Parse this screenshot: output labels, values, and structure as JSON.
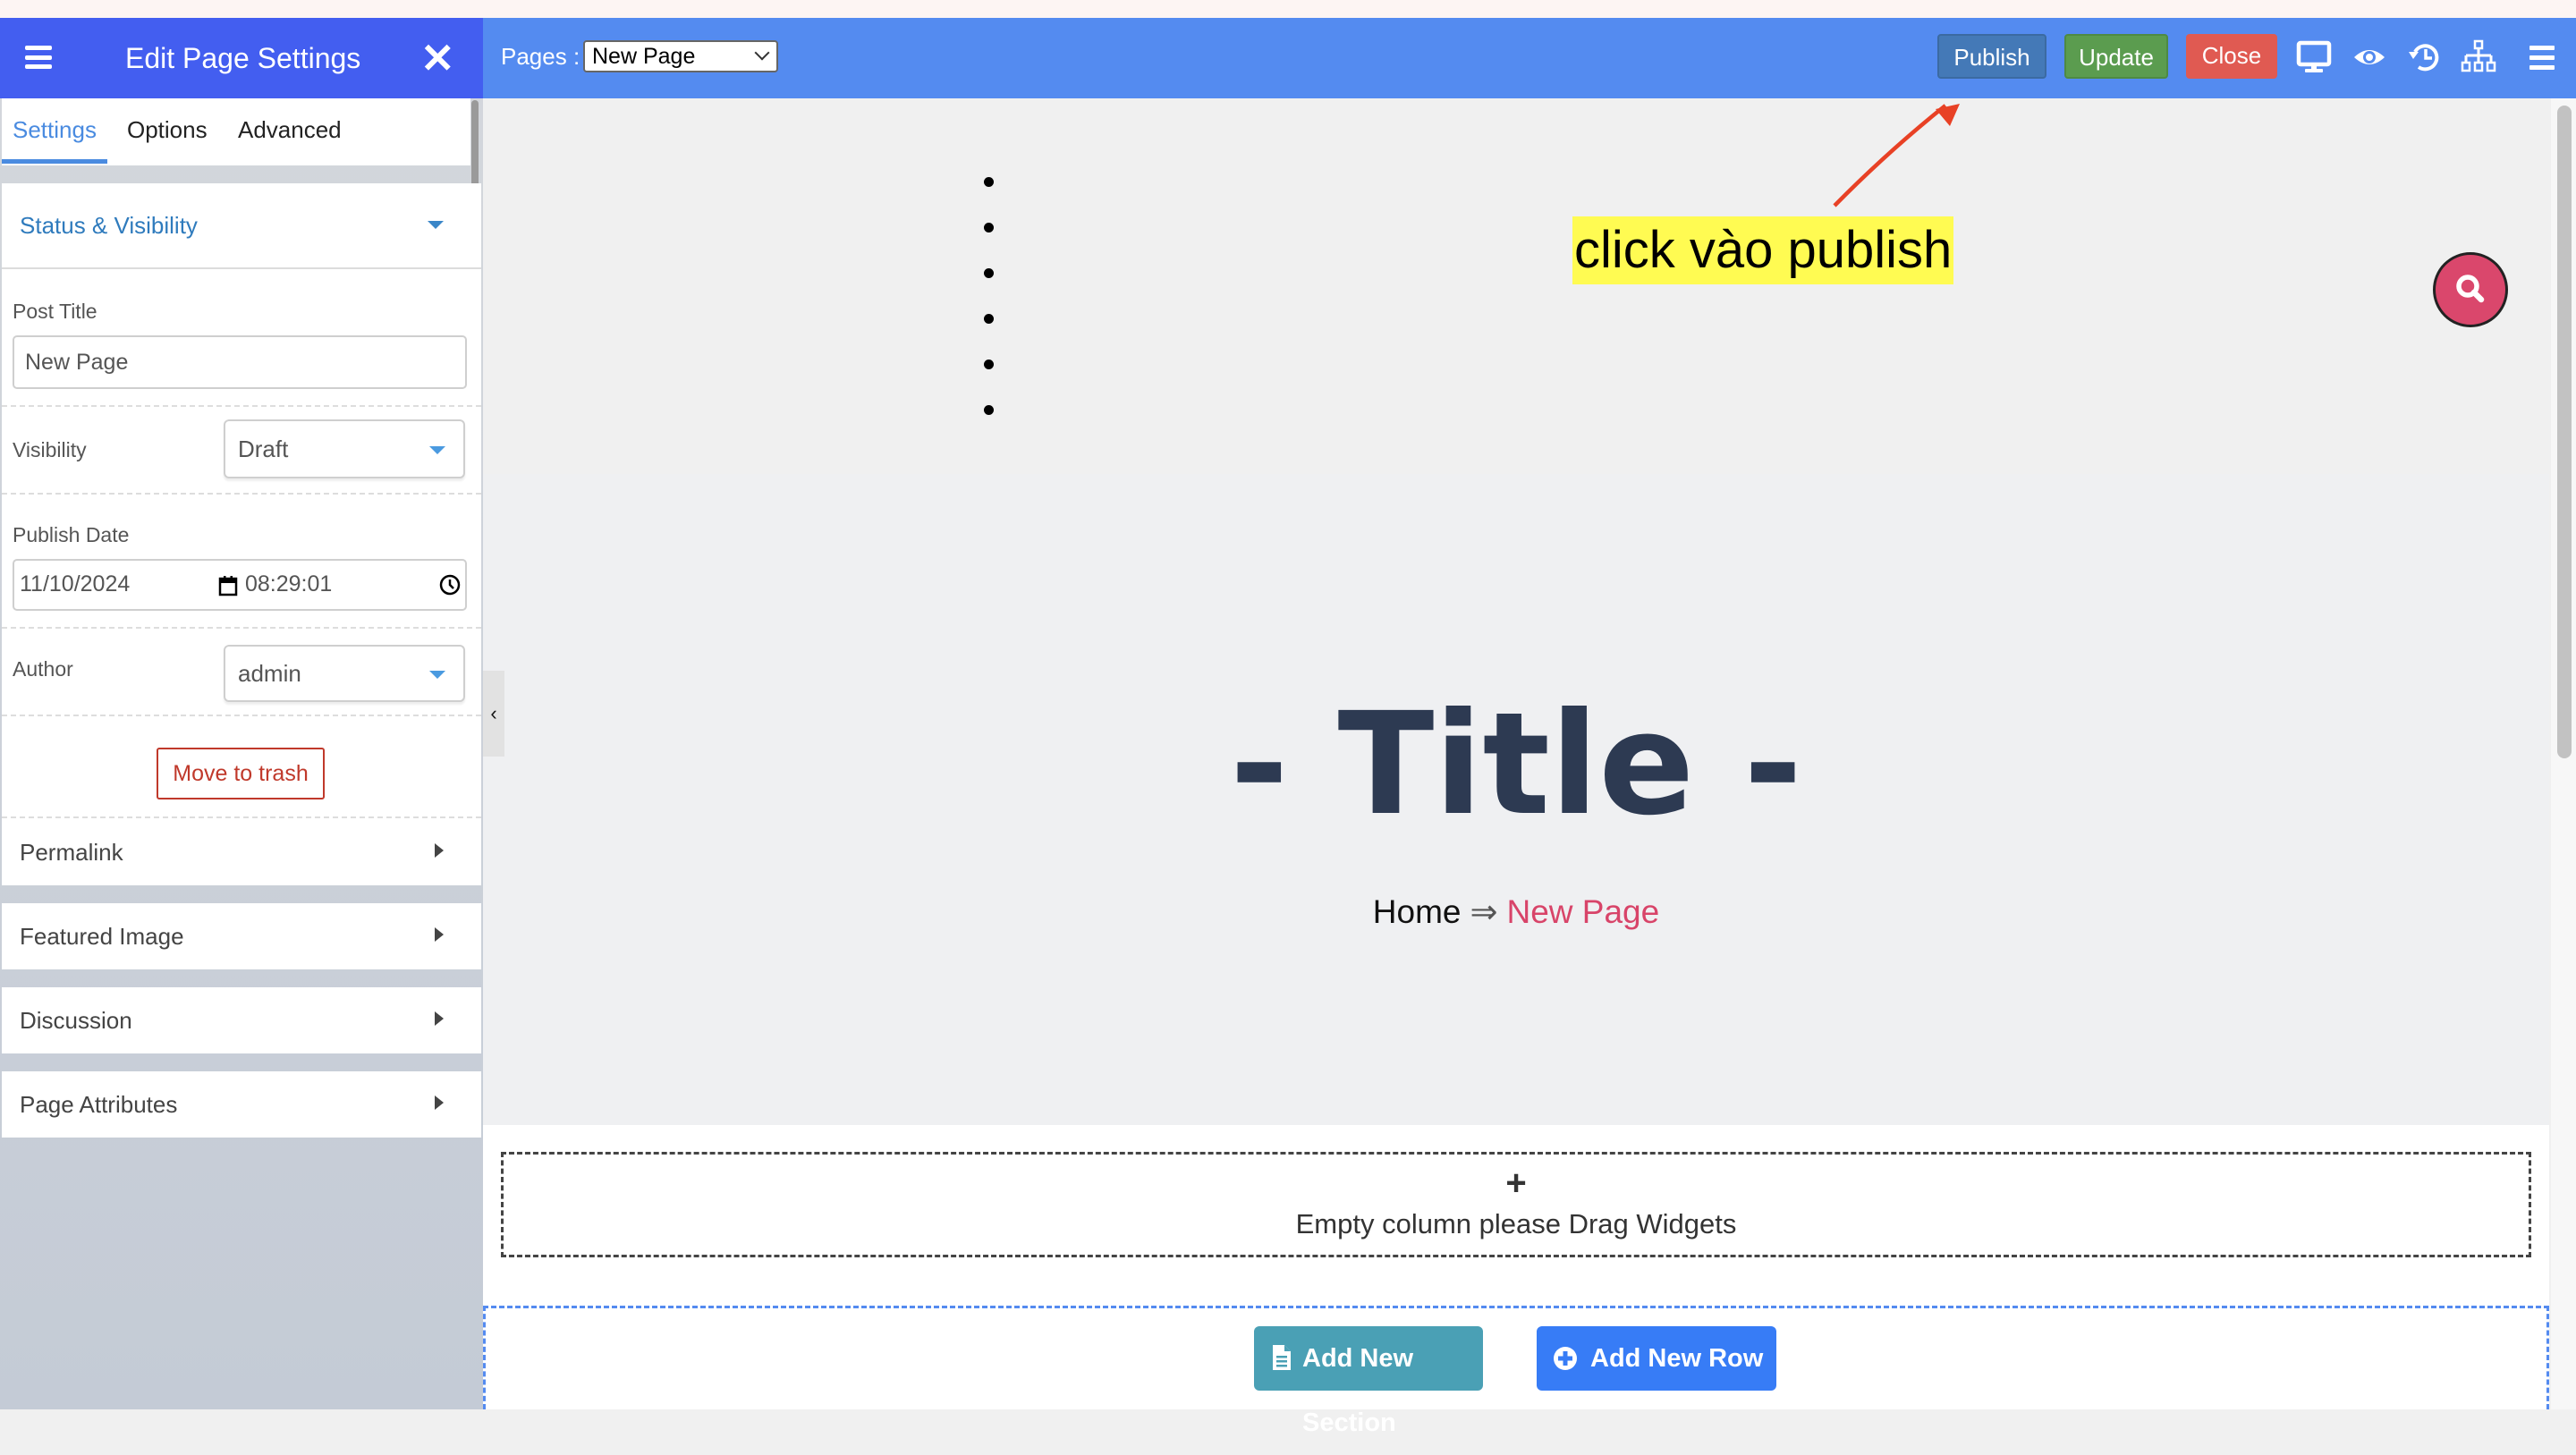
{
  "panel": {
    "title": "Edit Page Settings",
    "menu_icon": "hamburger-icon",
    "close_icon": "close-icon",
    "tabs": [
      {
        "label": "Settings",
        "active": true
      },
      {
        "label": "Options",
        "active": false
      },
      {
        "label": "Advanced",
        "active": false
      }
    ],
    "status_visibility": {
      "header": "Status & Visibility",
      "post_title_label": "Post Title",
      "post_title_value": "New Page",
      "visibility_label": "Visibility",
      "visibility_value": "Draft",
      "publish_date_label": "Publish Date",
      "publish_date_value": "11/10/2024",
      "publish_time_value": "08:29:01",
      "author_label": "Author",
      "author_value": "admin",
      "trash_label": "Move to trash"
    },
    "sections": [
      {
        "label": "Permalink"
      },
      {
        "label": "Featured Image"
      },
      {
        "label": "Discussion"
      },
      {
        "label": "Page Attributes"
      }
    ],
    "collapse_glyph": "‹"
  },
  "toolbar": {
    "pages_label": "Pages :",
    "pages_selected": "New Page",
    "publish_label": "Publish",
    "update_label": "Update",
    "close_label": "Close",
    "icons": [
      "desktop-icon",
      "eye-icon",
      "history-icon",
      "sitemap-icon",
      "menu-icon"
    ]
  },
  "canvas": {
    "bullet_count": 6,
    "annotation": "click vào publish",
    "title": "- Title -",
    "breadcrumb": {
      "home": "Home",
      "separator": "⇒",
      "current": "New Page"
    },
    "empty_plus": "+",
    "empty_text": "Empty column please Drag Widgets",
    "add_section_label": "Add New Section",
    "add_row_label": "Add New Row"
  },
  "colors": {
    "panel_header": "#435ef0",
    "toolbar": "#548bf0",
    "publish": "#4479b7",
    "update": "#5b9c4f",
    "close": "#e05a52",
    "accent_pink": "#d84469",
    "annotation_bg": "#fffb52",
    "arrow": "#e84125"
  }
}
